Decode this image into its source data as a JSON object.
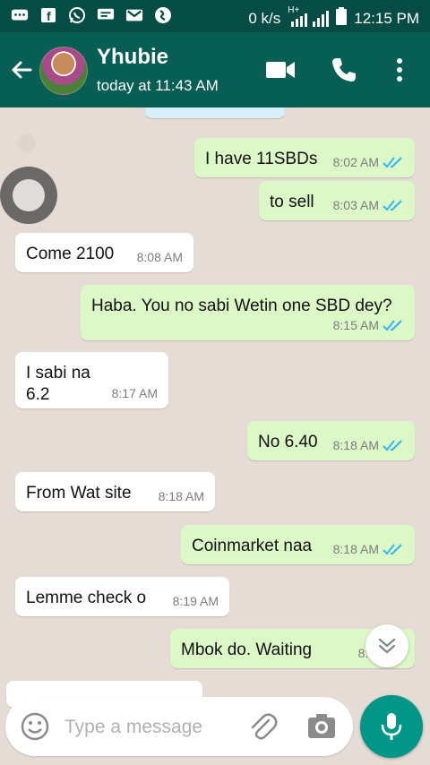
{
  "status_bar": {
    "net_speed": "0 k/s",
    "network": "H+",
    "time": "12:15 PM"
  },
  "app_bar": {
    "contact_name": "Yhubie",
    "last_seen": "today at 11:43 AM"
  },
  "messages": [
    {
      "text": "I have 11SBDs",
      "time": "8:02 AM",
      "dir": "out"
    },
    {
      "text": "to sell",
      "time": "8:03 AM",
      "dir": "out"
    },
    {
      "text": "Come 2100",
      "time": "8:08 AM",
      "dir": "in"
    },
    {
      "text": "Haba.  You no sabi Wetin one SBD dey?",
      "time": "8:15 AM",
      "dir": "out"
    },
    {
      "text": "I sabi na\n6.2",
      "time": "8:17 AM",
      "dir": "in"
    },
    {
      "text": "No 6.40",
      "time": "8:18 AM",
      "dir": "out"
    },
    {
      "text": "From Wat site",
      "time": "8:18 AM",
      "dir": "in"
    },
    {
      "text": "Coinmarket naa",
      "time": "8:18 AM",
      "dir": "out"
    },
    {
      "text": "Lemme check o",
      "time": "8:19 AM",
      "dir": "in"
    },
    {
      "text": "Mbok do. Waiting",
      "time": "8:20 AM",
      "dir": "out"
    }
  ],
  "composer": {
    "placeholder": "Type a message"
  },
  "colors": {
    "appbar": "#075e54",
    "statusbar": "#054d44",
    "outgoing": "#dcf8c6",
    "incoming": "#ffffff",
    "read_tick": "#34b7f1",
    "fab": "#009688"
  }
}
